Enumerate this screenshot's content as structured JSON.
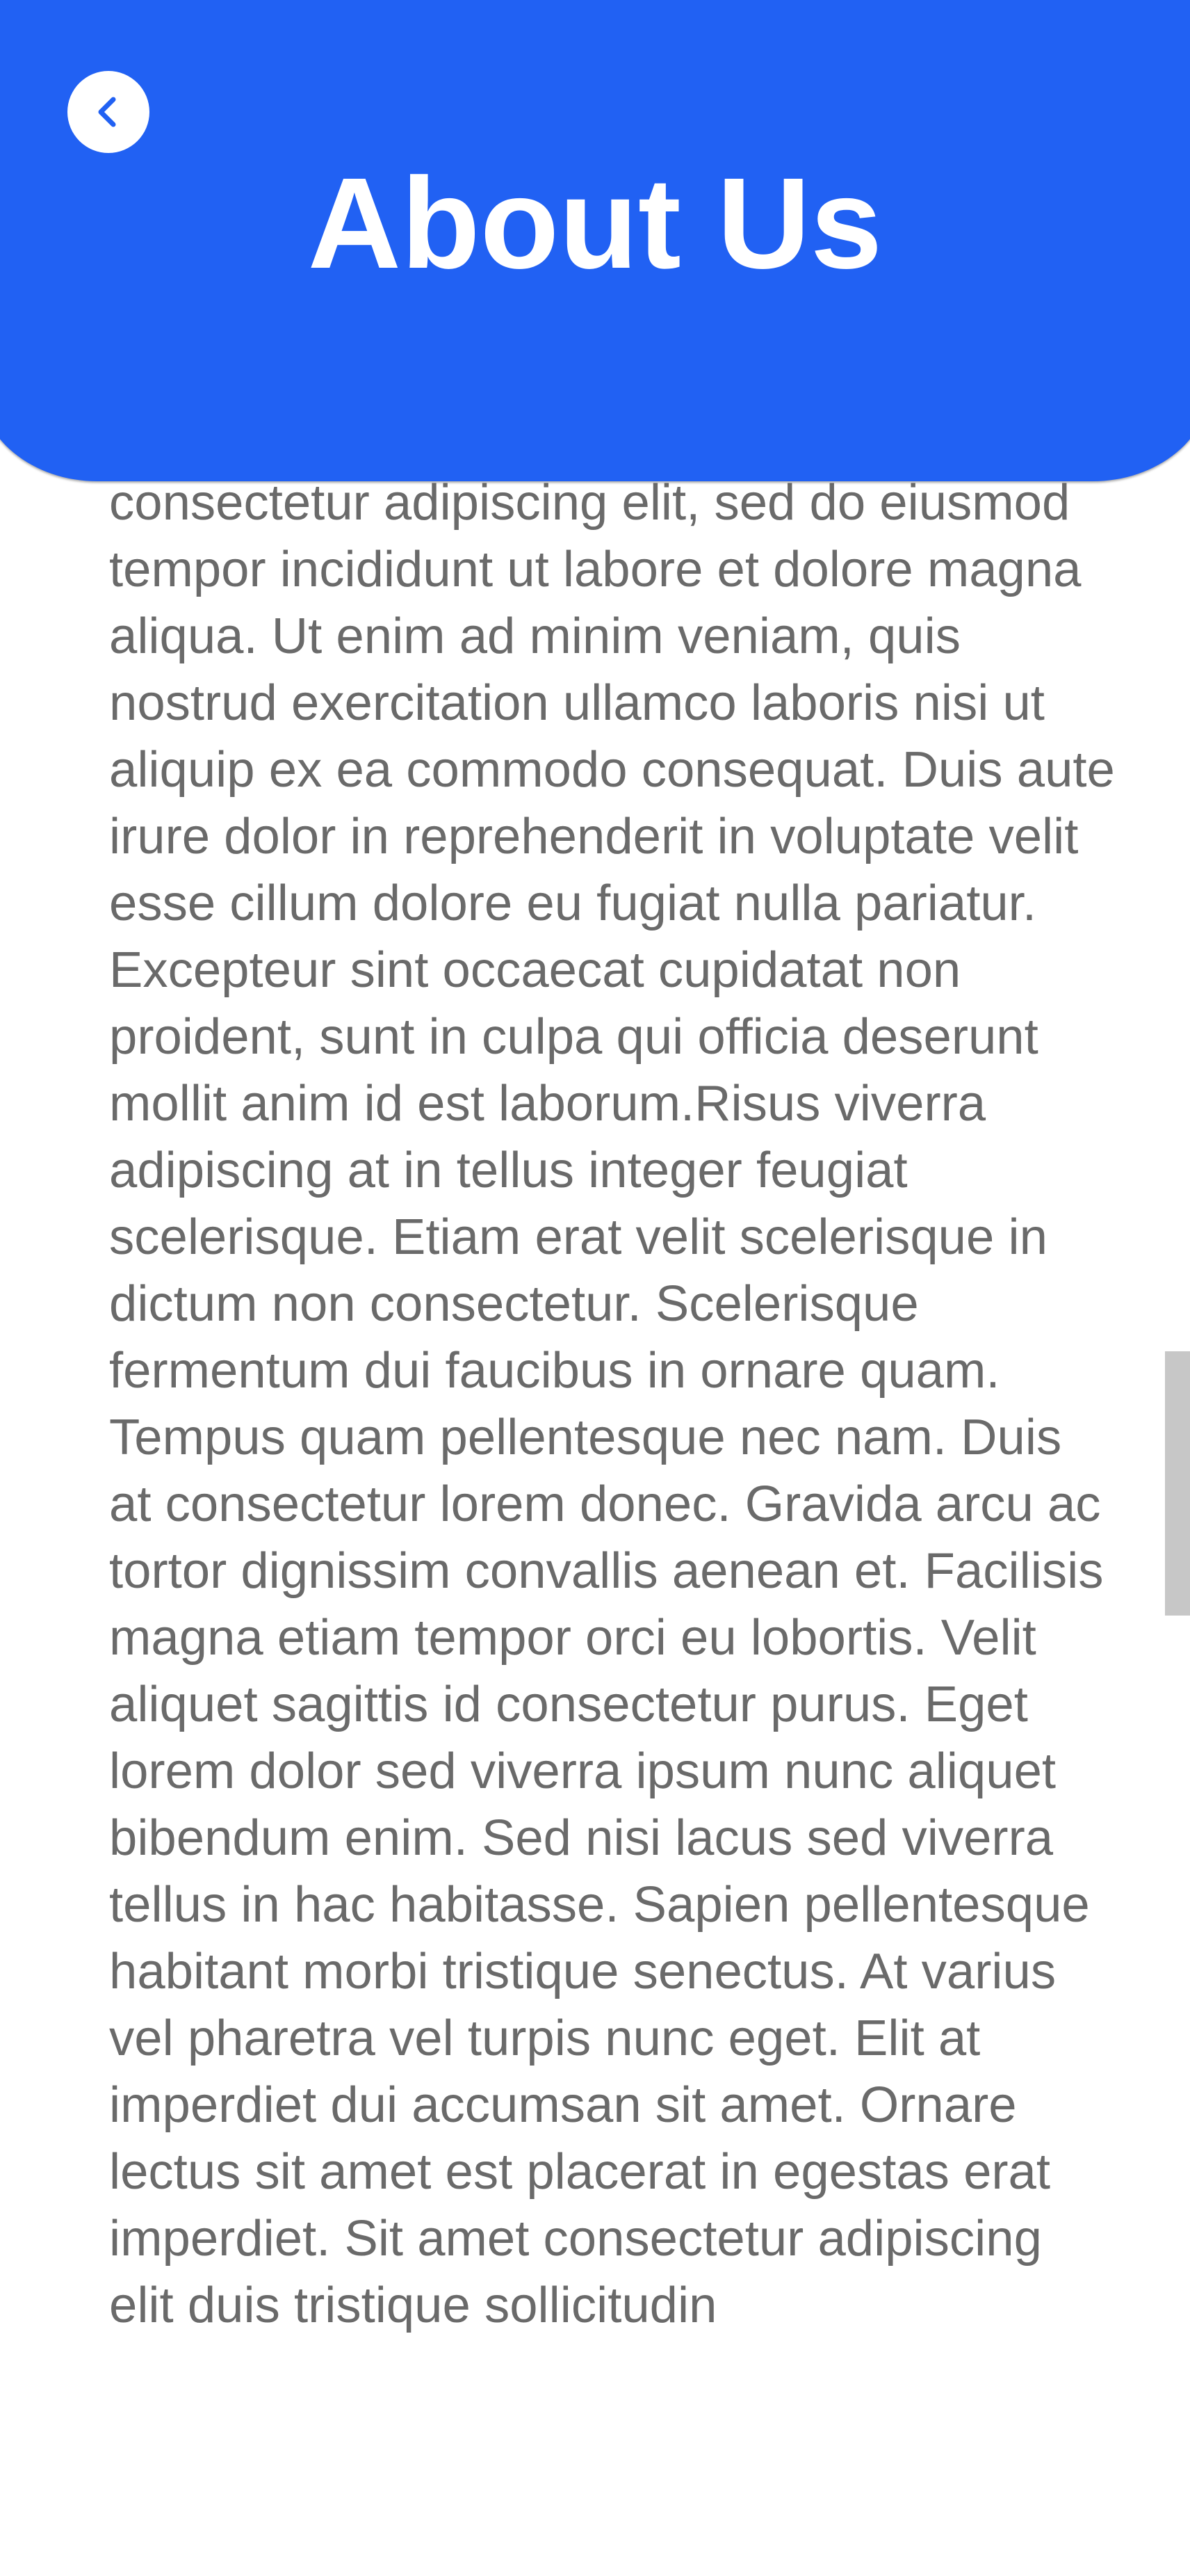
{
  "header": {
    "title": "About Us",
    "background_color": "#2161f3",
    "back_icon": "chevron-left-icon"
  },
  "content": {
    "body_text": "consectetur adipiscing elit, sed do eiusmod tempor incididunt ut labore et dolore magna aliqua. Ut enim ad minim veniam, quis nostrud exercitation ullamco laboris nisi ut aliquip ex ea commodo consequat. Duis aute irure dolor in reprehenderit in voluptate velit esse cillum dolore eu fugiat nulla pariatur. Excepteur sint occaecat cupidatat non proident, sunt in culpa qui officia deserunt mollit anim id est laborum.Risus viverra adipiscing at in tellus integer feugiat scelerisque. Etiam erat velit scelerisque in dictum non consectetur. Scelerisque fermentum dui faucibus in ornare quam. Tempus quam pellentesque nec nam. Duis at consectetur lorem donec. Gravida arcu ac tortor dignissim convallis aenean et. Facilisis magna etiam tempor orci eu lobortis. Velit aliquet sagittis id consectetur purus. Eget lorem dolor sed viverra ipsum nunc aliquet bibendum enim. Sed nisi lacus sed viverra tellus in hac habitasse. Sapien pellentesque habitant morbi tristique senectus. At varius vel pharetra vel turpis nunc eget. Elit at imperdiet dui accumsan sit amet. Ornare lectus sit amet est placerat in egestas erat imperdiet. Sit amet consectetur adipiscing elit duis tristique sollicitudin",
    "text_color": "#6a6a6a"
  }
}
